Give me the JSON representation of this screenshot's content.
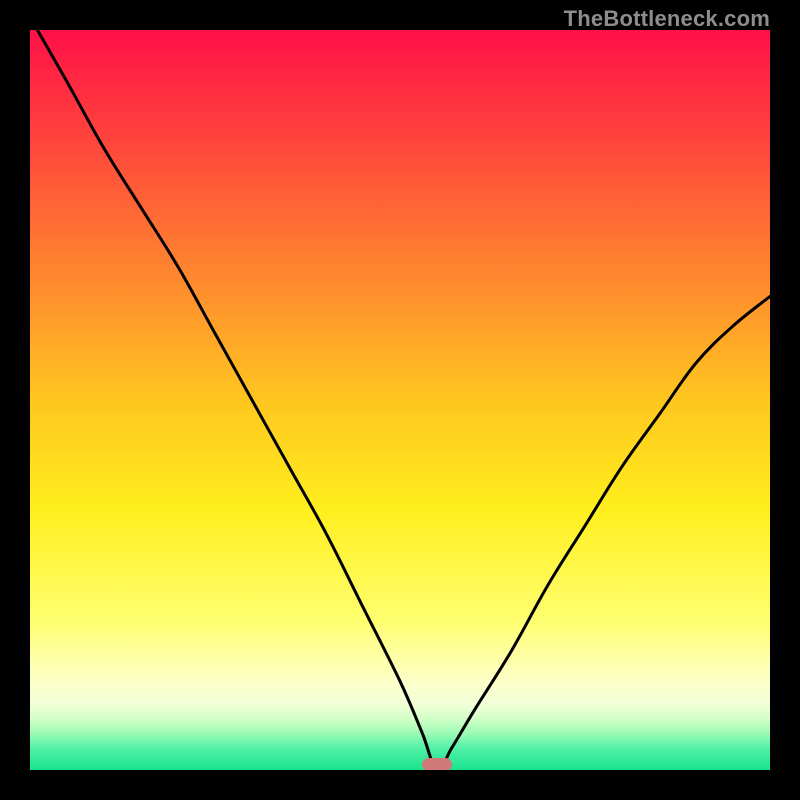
{
  "watermark": "TheBottleneck.com",
  "chart_data": {
    "type": "line",
    "title": "",
    "xlabel": "",
    "ylabel": "",
    "xlim": [
      0,
      100
    ],
    "ylim": [
      0,
      100
    ],
    "grid": false,
    "description": "Bottleneck curve over a vertical red-to-green gradient. Curve falls from top-left to a minimum near x≈55, then rises to the right.",
    "series": [
      {
        "name": "bottleneck-curve",
        "x": [
          1,
          5,
          10,
          15,
          20,
          25,
          30,
          35,
          40,
          45,
          50,
          53,
          55,
          57,
          60,
          65,
          70,
          75,
          80,
          85,
          90,
          95,
          100
        ],
        "y": [
          100,
          93,
          84,
          76,
          68,
          59,
          50,
          41,
          32,
          22,
          12,
          5,
          0,
          3,
          8,
          16,
          25,
          33,
          41,
          48,
          55,
          60,
          64
        ]
      }
    ],
    "marker": {
      "x": 55,
      "y": 0
    },
    "background_gradient_stops": [
      {
        "pos": 0.0,
        "color": "#ff1048"
      },
      {
        "pos": 0.17,
        "color": "#ff4c3a"
      },
      {
        "pos": 0.34,
        "color": "#ff8a2e"
      },
      {
        "pos": 0.5,
        "color": "#ffc61f"
      },
      {
        "pos": 0.65,
        "color": "#ffef1e"
      },
      {
        "pos": 0.8,
        "color": "#ffff71"
      },
      {
        "pos": 0.88,
        "color": "#fdffc8"
      },
      {
        "pos": 0.91,
        "color": "#f2ffd9"
      },
      {
        "pos": 0.93,
        "color": "#d3ffc8"
      },
      {
        "pos": 0.95,
        "color": "#9dfcb4"
      },
      {
        "pos": 0.97,
        "color": "#54f0a7"
      },
      {
        "pos": 1.0,
        "color": "#17e48e"
      }
    ]
  }
}
